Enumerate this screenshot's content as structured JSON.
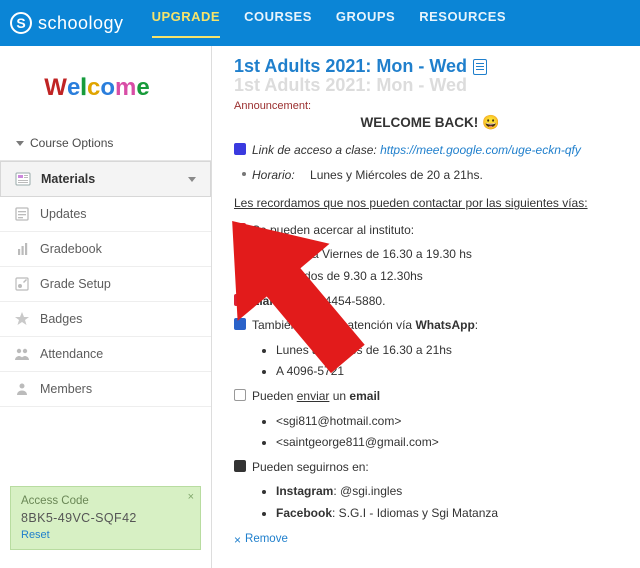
{
  "header": {
    "brand": "schoology",
    "nav": {
      "upgrade": "UPGRADE",
      "courses": "COURSES",
      "groups": "GROUPS",
      "resources": "RESOURCES"
    }
  },
  "sidebar": {
    "course_options": "Course Options",
    "items": [
      {
        "label": "Materials"
      },
      {
        "label": "Updates"
      },
      {
        "label": "Gradebook"
      },
      {
        "label": "Grade Setup"
      },
      {
        "label": "Badges"
      },
      {
        "label": "Attendance"
      },
      {
        "label": "Members"
      }
    ],
    "access": {
      "title": "Access Code",
      "code": "8BK5-49VC-SQF42",
      "reset": "Reset",
      "close": "×"
    }
  },
  "main": {
    "title": "1st Adults 2021: Mon - Wed",
    "ghost_title": "1st Adults 2021: Mon - Wed",
    "announcement_label": "Announcement:",
    "welcome_back": "WELCOME BACK!",
    "link_label": "Link de acceso a clase:",
    "meet_link": "https://meet.google.com/uge-eckn-qfy",
    "horario_label": "Horario:",
    "horario_text": "Lunes y Miércoles de 20 a 21hs.",
    "reminder": "Les recordamos que nos pueden contactar por las siguientes vías:",
    "visit_label": "Se pueden acercar al instituto:",
    "visit_days_1": "Lunes a Viernes de 16.30 a 19.30 hs",
    "visit_days_2": "Sábados de 9.30 a 12.30hs",
    "call_pre": "Llamando",
    "call_post": " al 4454-5880.",
    "whats_pre": "También,",
    "whats_mid": " nuestra atención vía ",
    "whats_bold": "WhatsApp",
    "whats_time": "Lunes a Viernes de 16.30 a 21hs",
    "whats_num": "A   4096-5721",
    "email_pre": "Pueden ",
    "email_mid": "enviar",
    "email_post": " un ",
    "email_bold": "email",
    "email_1": "<sgi811@hotmail.com>",
    "email_2": "<saintgeorge811@gmail.com>",
    "follow_label": "Pueden seguirnos en:",
    "ig_label": "Instagram",
    "ig_val": ": @sgi.ingles",
    "fb_label": "Facebook",
    "fb_val": ": S.G.I - Idiomas y Sgi Matanza",
    "remove": "Remove"
  }
}
